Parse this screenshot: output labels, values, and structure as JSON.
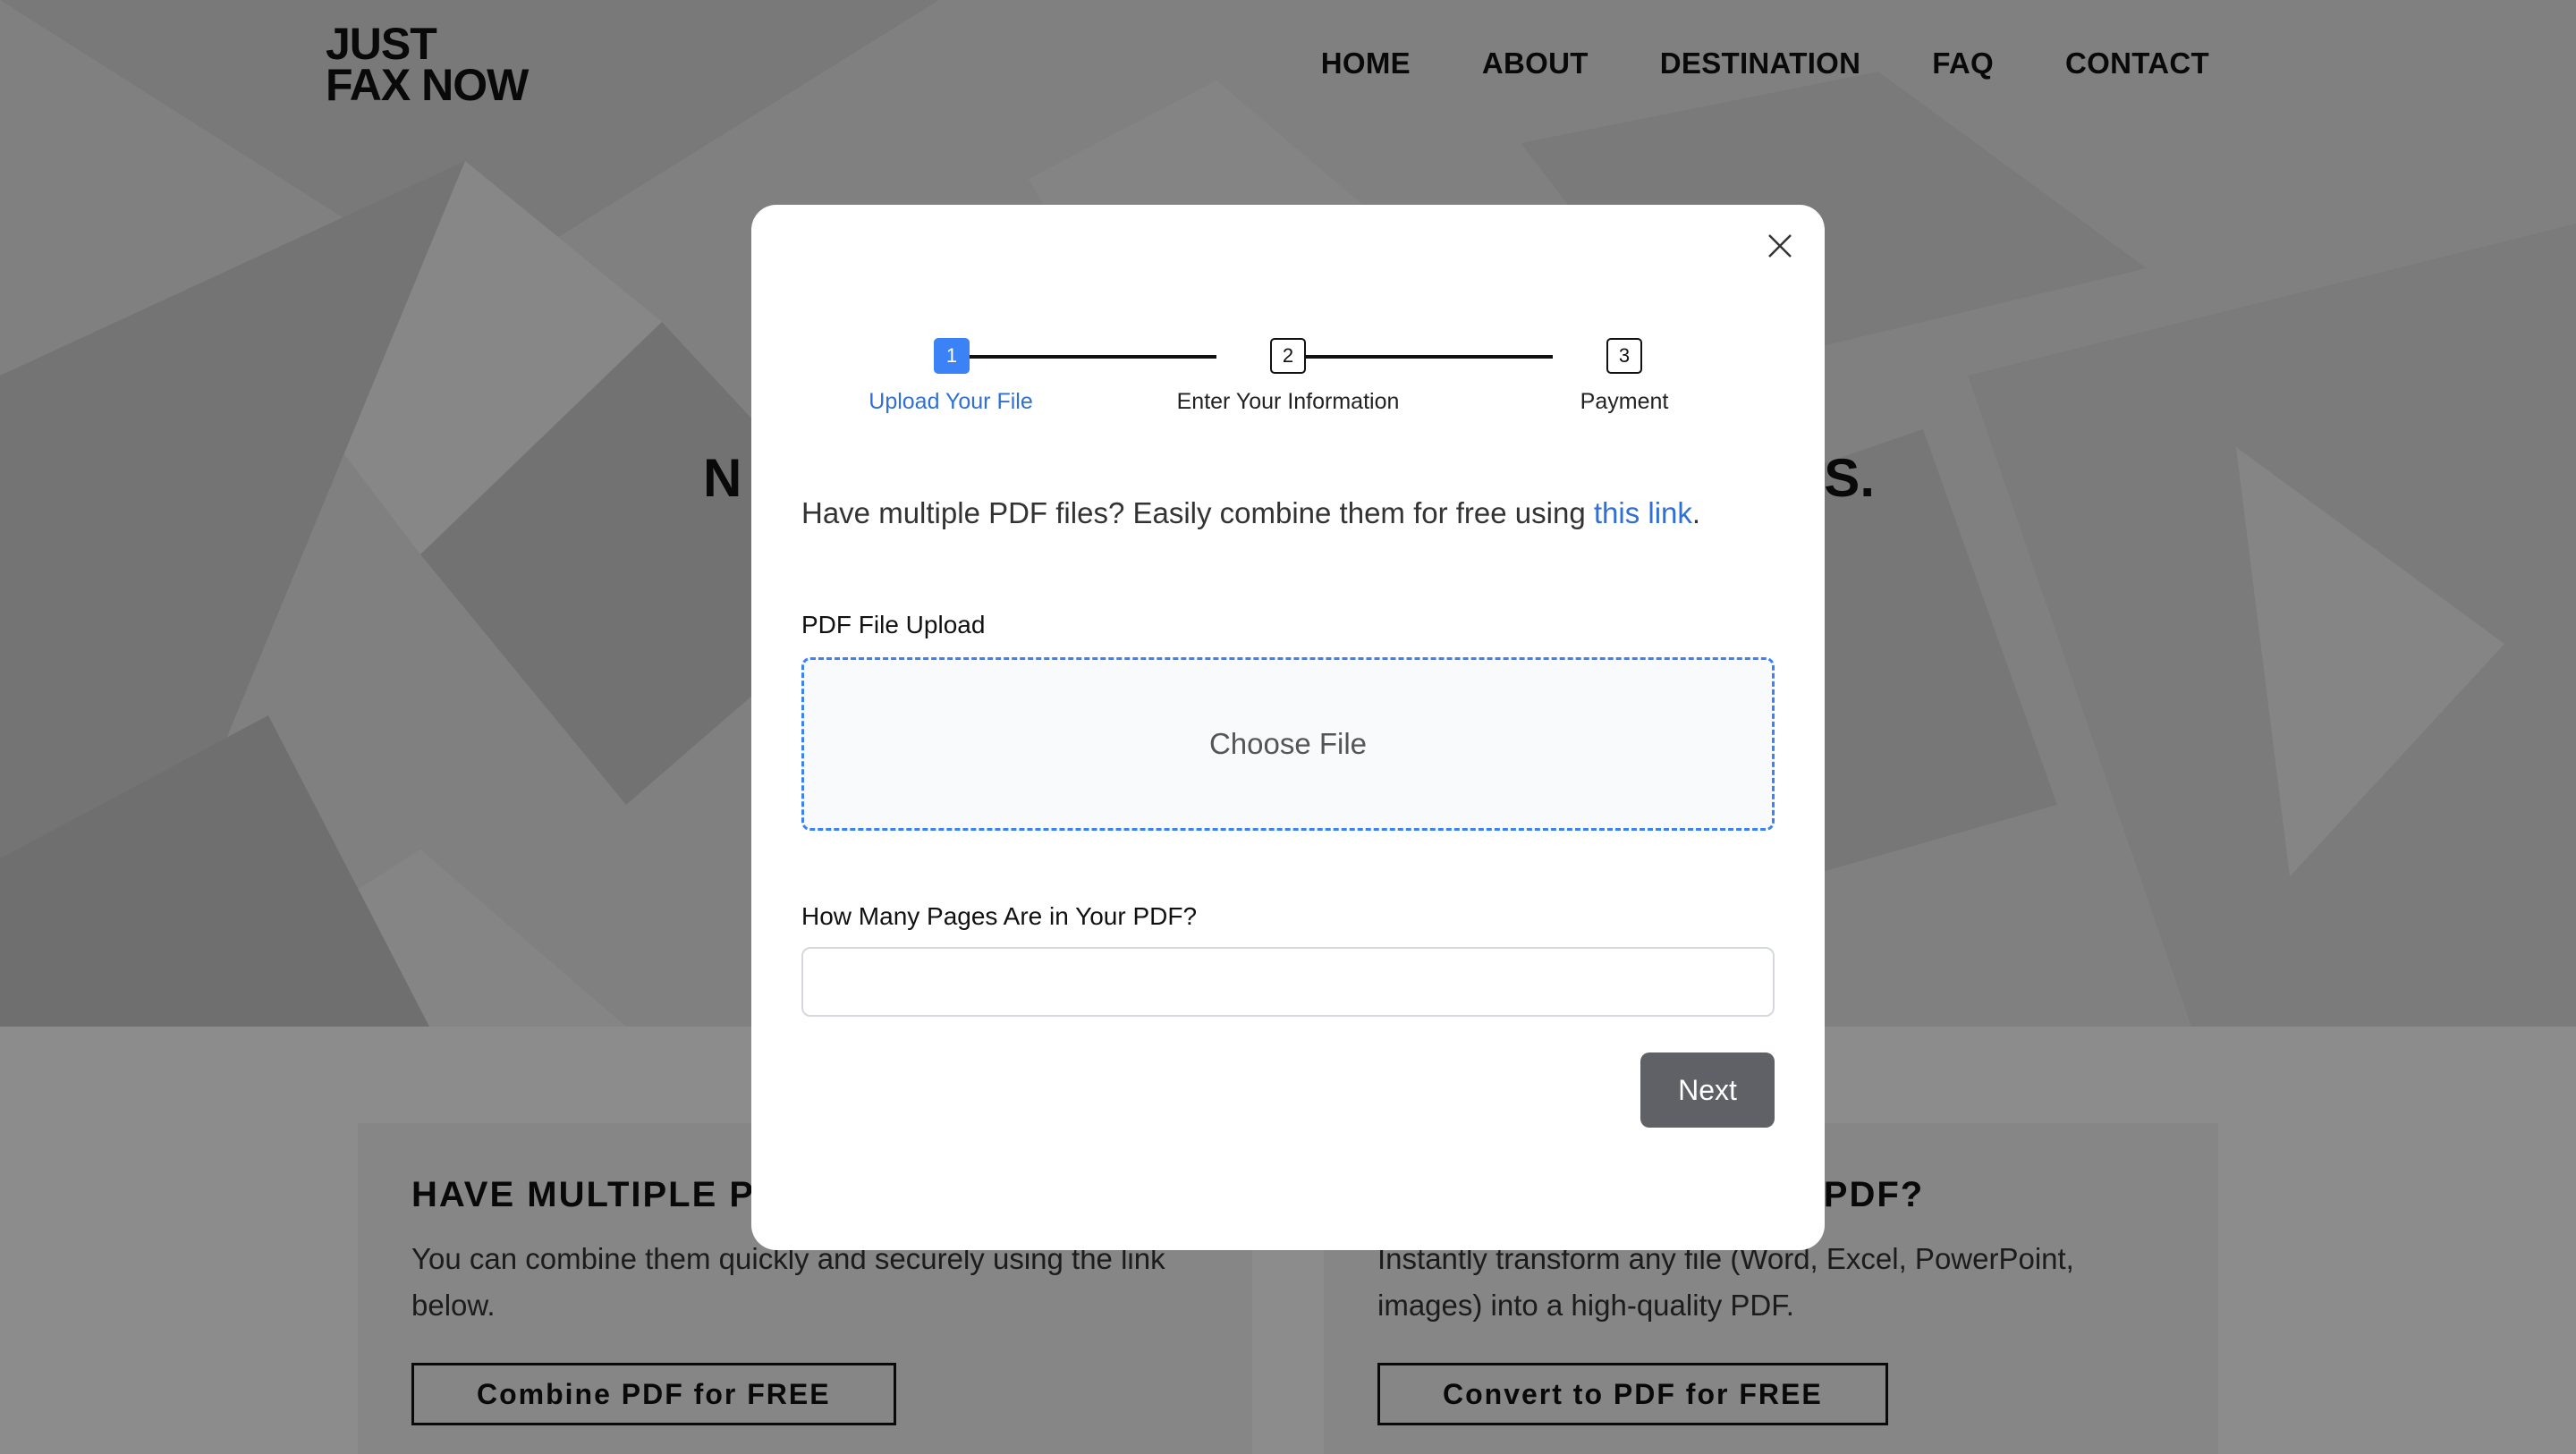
{
  "header": {
    "logo_line1": "JUST",
    "logo_line2": "FAX NOW",
    "nav": [
      "HOME",
      "ABOUT",
      "DESTINATION",
      "FAQ",
      "CONTACT"
    ]
  },
  "hero": {
    "heading_left": "N",
    "heading_right": "S."
  },
  "cards": {
    "left": {
      "title": "HAVE MULTIPLE PDF FILES?",
      "text": "You can combine them quickly and securely using the link below.",
      "button": "Combine PDF for FREE"
    },
    "right": {
      "title": "NEED TO CONVERT TO PDF?",
      "text": "Instantly transform any file (Word, Excel, PowerPoint, images) into a high-quality PDF.",
      "button": "Convert to PDF for FREE"
    }
  },
  "modal": {
    "steps": [
      {
        "number": "1",
        "label": "Upload Your File"
      },
      {
        "number": "2",
        "label": "Enter Your Information"
      },
      {
        "number": "3",
        "label": "Payment"
      }
    ],
    "intro_text": "Have multiple PDF files? Easily combine them for free using ",
    "intro_link": "this link",
    "intro_end": ".",
    "upload_label": "PDF File Upload",
    "upload_button": "Choose File",
    "pages_label": "How Many Pages Are in Your PDF?",
    "pages_value": "",
    "next_button": "Next"
  },
  "colors": {
    "accent": "#3b82f6",
    "link": "#2f6fd6",
    "next_button_bg": "#5f6166",
    "overlay": "rgba(0,0,0,0.45)"
  }
}
